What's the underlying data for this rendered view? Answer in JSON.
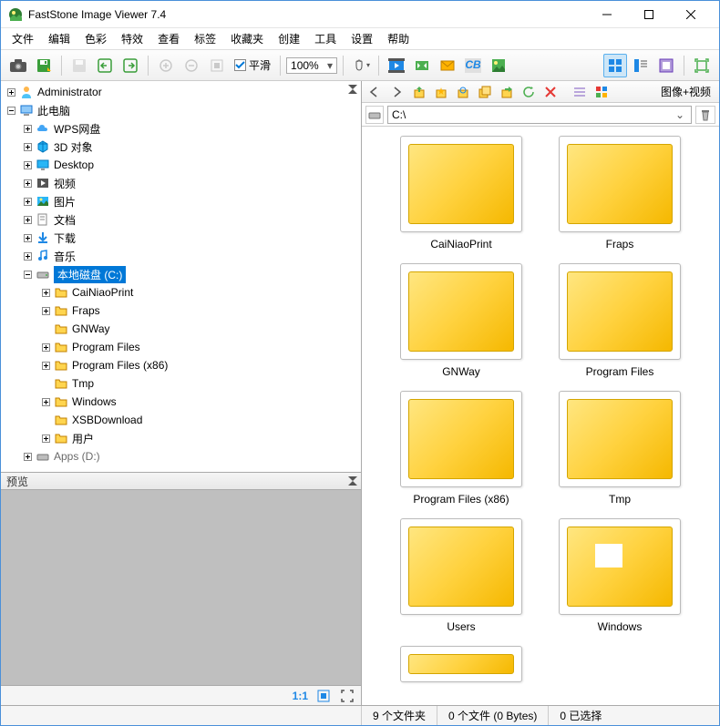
{
  "window": {
    "title": "FastStone Image Viewer 7.4"
  },
  "menu": {
    "items": [
      "文件",
      "编辑",
      "色彩",
      "特效",
      "查看",
      "标签",
      "收藏夹",
      "创建",
      "工具",
      "设置",
      "帮助"
    ]
  },
  "toolbar": {
    "smooth_label": "平滑",
    "zoom_value": "100%"
  },
  "tree": {
    "administrator": "Administrator",
    "this_pc": "此电脑",
    "wps": "WPS网盘",
    "objects3d": "3D 对象",
    "desktop": "Desktop",
    "videos": "视频",
    "pictures": "图片",
    "documents": "文档",
    "downloads": "下载",
    "music": "音乐",
    "local_disk_c": "本地磁盘 (C:)",
    "c_children": [
      "CaiNiaoPrint",
      "Fraps",
      "GNWay",
      "Program Files",
      "Program Files (x86)",
      "Tmp",
      "Windows",
      "XSBDownload",
      "用户"
    ],
    "apps_d": "Apps (D:)"
  },
  "preview": {
    "title": "预览",
    "ratio": "1:1"
  },
  "right_toolbar": {
    "filter_label": "图像+视频"
  },
  "path": {
    "value": "C:\\"
  },
  "thumbnails": {
    "items": [
      "CaiNiaoPrint",
      "Fraps",
      "GNWay",
      "Program Files",
      "Program Files (x86)",
      "Tmp",
      "Users",
      "Windows"
    ]
  },
  "statusbar": {
    "folders": "9 个文件夹",
    "files": "0 个文件 (0 Bytes)",
    "selected": "0 已选择"
  }
}
